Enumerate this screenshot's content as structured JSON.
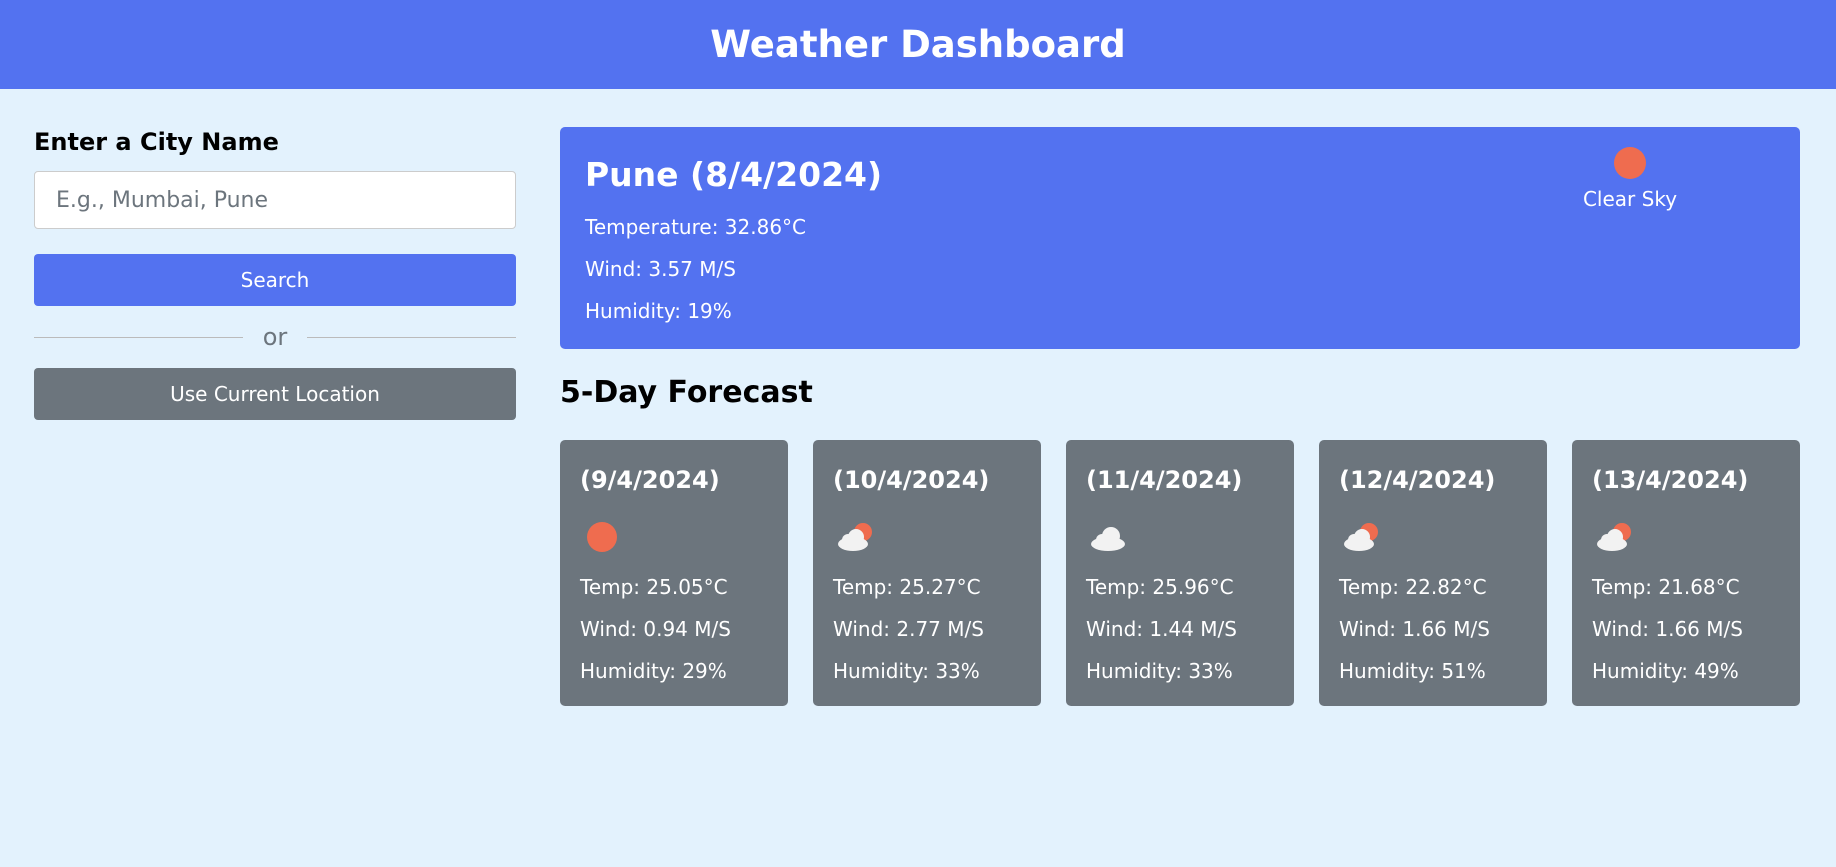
{
  "header": {
    "title": "Weather Dashboard"
  },
  "sidebar": {
    "label": "Enter a City Name",
    "input_placeholder": "E.g., Mumbai, Pune",
    "search_label": "Search",
    "divider_text": "or",
    "location_label": "Use Current Location"
  },
  "current": {
    "title": "Pune (8/4/2024)",
    "temperature": "Temperature: 32.86°C",
    "wind": "Wind: 3.57 M/S",
    "humidity": "Humidity: 19%",
    "description": "Clear Sky",
    "icon": "sun-icon"
  },
  "forecast": {
    "title": "5-Day Forecast",
    "days": [
      {
        "date": "(9/4/2024)",
        "icon": "sun-icon",
        "temp": "Temp: 25.05°C",
        "wind": "Wind: 0.94 M/S",
        "humidity": "Humidity: 29%"
      },
      {
        "date": "(10/4/2024)",
        "icon": "cloud-sun-icon",
        "temp": "Temp: 25.27°C",
        "wind": "Wind: 2.77 M/S",
        "humidity": "Humidity: 33%"
      },
      {
        "date": "(11/4/2024)",
        "icon": "cloud-icon",
        "temp": "Temp: 25.96°C",
        "wind": "Wind: 1.44 M/S",
        "humidity": "Humidity: 33%"
      },
      {
        "date": "(12/4/2024)",
        "icon": "cloud-sun-icon",
        "temp": "Temp: 22.82°C",
        "wind": "Wind: 1.66 M/S",
        "humidity": "Humidity: 51%"
      },
      {
        "date": "(13/4/2024)",
        "icon": "cloud-sun-icon",
        "temp": "Temp: 21.68°C",
        "wind": "Wind: 1.66 M/S",
        "humidity": "Humidity: 49%"
      }
    ]
  },
  "colors": {
    "primary": "#5372F0",
    "secondary": "#6C757D",
    "background": "#E3F2FD",
    "sun": "#EF6C4F"
  }
}
